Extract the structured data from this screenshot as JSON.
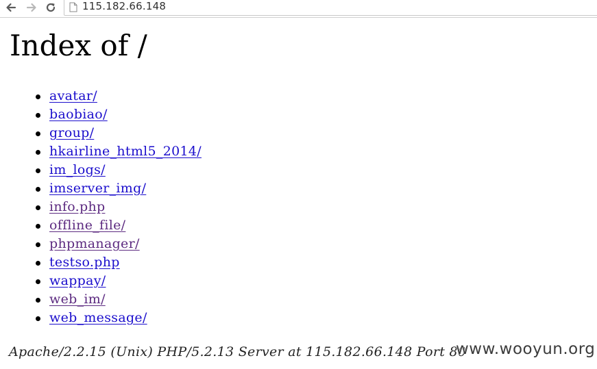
{
  "browser": {
    "url": "115.182.66.148",
    "icons": {
      "back": "back-arrow-icon",
      "forward": "forward-arrow-icon",
      "reload": "reload-icon",
      "page": "page-icon"
    }
  },
  "page": {
    "title": "Index of /",
    "items": [
      {
        "label": "avatar/",
        "visited": false
      },
      {
        "label": "baobiao/",
        "visited": false
      },
      {
        "label": "group/",
        "visited": false
      },
      {
        "label": "hkairline_html5_2014/",
        "visited": false
      },
      {
        "label": "im_logs/",
        "visited": false
      },
      {
        "label": "imserver_img/",
        "visited": false
      },
      {
        "label": "info.php",
        "visited": true
      },
      {
        "label": "offline_file/",
        "visited": true
      },
      {
        "label": "phpmanager/",
        "visited": true
      },
      {
        "label": "testso.php",
        "visited": false
      },
      {
        "label": "wappay/",
        "visited": false
      },
      {
        "label": "web_im/",
        "visited": true
      },
      {
        "label": "web_message/",
        "visited": false
      }
    ],
    "server_signature": "Apache/2.2.15 (Unix) PHP/5.2.13 Server at 115.182.66.148 Port 80"
  },
  "watermark": "www.wooyun.org",
  "colors": {
    "link": "#1a0dcc",
    "visited_link": "#5c2a80"
  }
}
